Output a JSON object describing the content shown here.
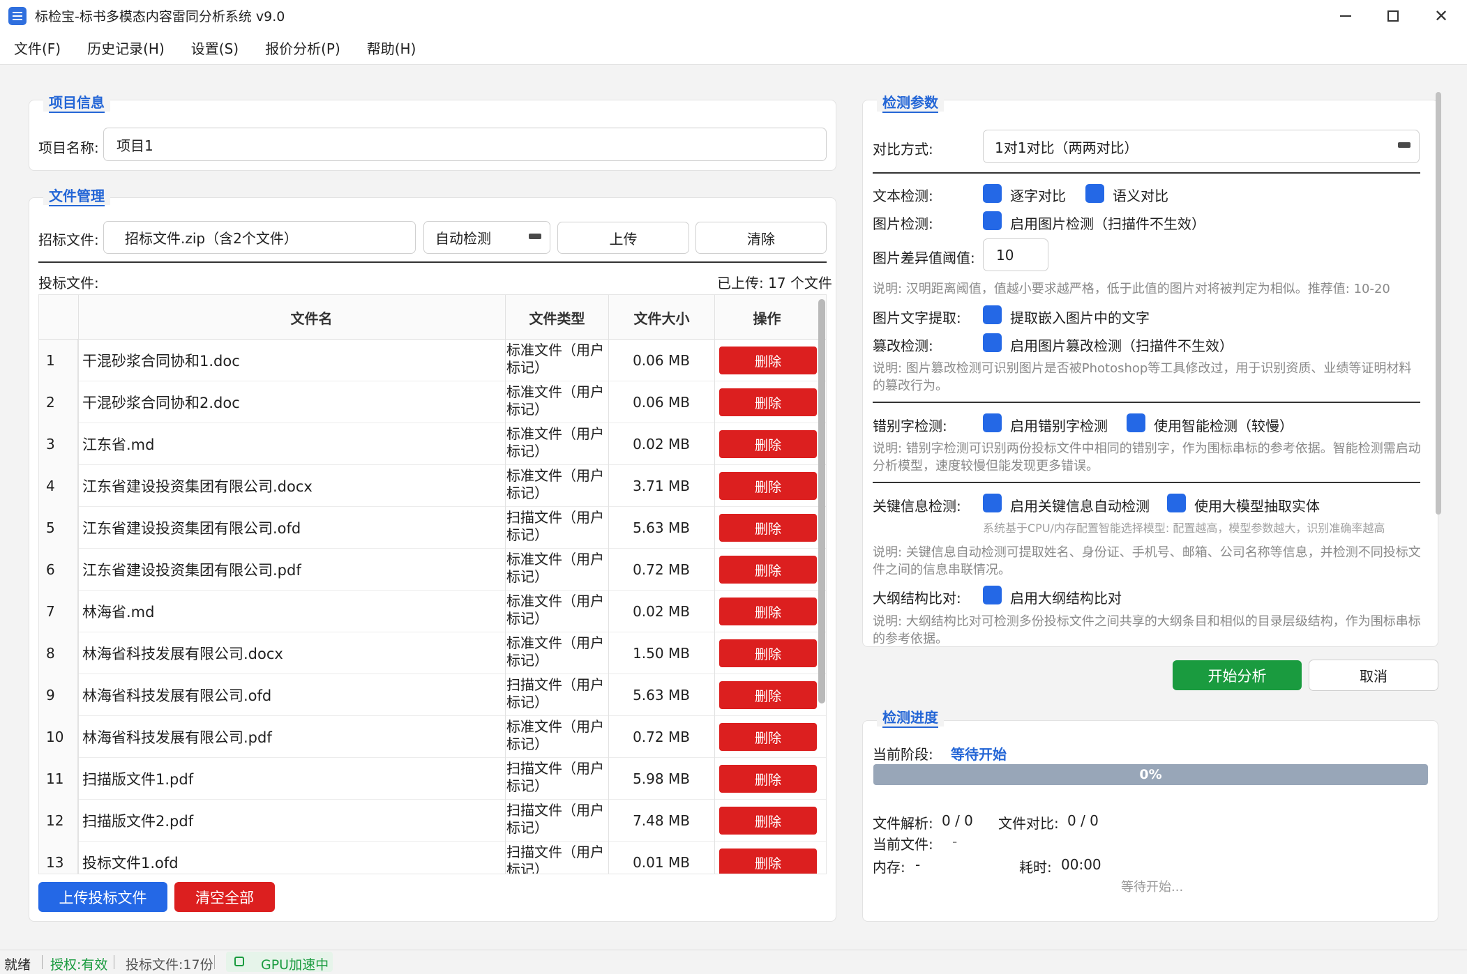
{
  "window": {
    "title": "标检宝-标书多模态内容雷同分析系统 v9.0",
    "close_glyph": "✕"
  },
  "menu": [
    "文件(F)",
    "历史记录(H)",
    "设置(S)",
    "报价分析(P)",
    "帮助(H)"
  ],
  "project": {
    "section_title": "项目信息",
    "name_label": "项目名称:",
    "name_value": "项目1"
  },
  "files": {
    "section_title": "文件管理",
    "tender_label": "招标文件:",
    "tender_value": "招标文件.zip（含2个文件）",
    "detect_mode": "自动检测",
    "upload_label": "上传",
    "clear_label": "清除",
    "bid_label": "投标文件:",
    "uploaded_count": "已上传: 17 个文件",
    "columns": [
      "文件名",
      "文件类型",
      "文件大小",
      "操作"
    ],
    "delete_label": "删除",
    "rows": [
      {
        "idx": "1",
        "name": "干混砂浆合同协和1.doc",
        "type": "标准文件（用户标记）",
        "size": "0.06 MB"
      },
      {
        "idx": "2",
        "name": "干混砂浆合同协和2.doc",
        "type": "标准文件（用户标记）",
        "size": "0.06 MB"
      },
      {
        "idx": "3",
        "name": "江东省.md",
        "type": "标准文件（用户标记）",
        "size": "0.02 MB"
      },
      {
        "idx": "4",
        "name": "江东省建设投资集团有限公司.docx",
        "type": "标准文件（用户标记）",
        "size": "3.71 MB"
      },
      {
        "idx": "5",
        "name": "江东省建设投资集团有限公司.ofd",
        "type": "扫描文件（用户标记）",
        "size": "5.63 MB"
      },
      {
        "idx": "6",
        "name": "江东省建设投资集团有限公司.pdf",
        "type": "标准文件（用户标记）",
        "size": "0.72 MB"
      },
      {
        "idx": "7",
        "name": "林海省.md",
        "type": "标准文件（用户标记）",
        "size": "0.02 MB"
      },
      {
        "idx": "8",
        "name": "林海省科技发展有限公司.docx",
        "type": "标准文件（用户标记）",
        "size": "1.50 MB"
      },
      {
        "idx": "9",
        "name": "林海省科技发展有限公司.ofd",
        "type": "扫描文件（用户标记）",
        "size": "5.63 MB"
      },
      {
        "idx": "10",
        "name": "林海省科技发展有限公司.pdf",
        "type": "标准文件（用户标记）",
        "size": "0.72 MB"
      },
      {
        "idx": "11",
        "name": "扫描版文件1.pdf",
        "type": "扫描文件（用户标记）",
        "size": "5.98 MB"
      },
      {
        "idx": "12",
        "name": "扫描版文件2.pdf",
        "type": "扫描文件（用户标记）",
        "size": "7.48 MB"
      },
      {
        "idx": "13",
        "name": "投标文件1.ofd",
        "type": "扫描文件（用户标记）",
        "size": "0.01 MB"
      }
    ],
    "upload_bid_label": "上传投标文件",
    "clear_all_label": "清空全部"
  },
  "params": {
    "section_title": "检测参数",
    "compare_label": "对比方式:",
    "compare_value": "1对1对比（两两对比）",
    "text_label": "文本检测:",
    "text_opt1": "逐字对比",
    "text_opt2": "语义对比",
    "image_label": "图片检测:",
    "image_opt": "启用图片检测（扫描件不生效）",
    "threshold_label": "图片差异值阈值:",
    "threshold_value": "10",
    "threshold_note": "说明: 汉明距离阈值，值越小要求越严格，低于此值的图片对将被判定为相似。推荐值: 10-20",
    "ocr_label": "图片文字提取:",
    "ocr_opt": "提取嵌入图片中的文字",
    "tamper_label": "篡改检测:",
    "tamper_opt": "启用图片篡改检测（扫描件不生效）",
    "tamper_note": "说明: 图片篡改检测可识别图片是否被Photoshop等工具修改过，用于识别资质、业绩等证明材料的篡改行为。",
    "typo_label": "错别字检测:",
    "typo_opt1": "启用错别字检测",
    "typo_opt2": "使用智能检测（较慢）",
    "typo_note": "说明: 错别字检测可识别两份投标文件中相同的错别字，作为围标串标的参考依据。智能检测需启动分析模型，速度较慢但能发现更多错误。",
    "key_label": "关键信息检测:",
    "key_opt1": "启用关键信息自动检测",
    "key_opt2": "使用大模型抽取实体",
    "key_hint": "系统基于CPU/内存配置智能选择模型: 配置越高，模型参数越大，识别准确率越高",
    "key_note": "说明: 关键信息自动检测可提取姓名、身份证、手机号、邮箱、公司名称等信息，并检测不同投标文件之间的信息串联情况。",
    "outline_label": "大纲结构比对:",
    "outline_opt": "启用大纲结构比对",
    "outline_note": "说明: 大纲结构比对可检测多份投标文件之间共享的大纲条目和相似的目录层级结构，作为围标串标的参考依据。",
    "start_label": "开始分析",
    "cancel_label": "取消"
  },
  "progress": {
    "section_title": "检测进度",
    "stage_label": "当前阶段:",
    "stage_value": "等待开始",
    "percent": 0,
    "percent_text": "0%",
    "parse_label": "文件解析:",
    "parse_value": "0 / 0",
    "compare_label": "文件对比:",
    "compare_value": "0 / 0",
    "current_label": "当前文件:",
    "current_value": "-",
    "memory_label": "内存:",
    "memory_value": "-",
    "time_label": "耗时:",
    "time_value": "00:00",
    "waiting": "等待开始..."
  },
  "status": {
    "ready": "就绪",
    "license": "授权:有效",
    "bid_count": "投标文件:17份",
    "gpu": "GPU加速中"
  },
  "colors": {
    "accent": "#2466d6",
    "danger": "#dc1f1f",
    "success": "#1a9b3f",
    "primary": "#2468e6"
  }
}
